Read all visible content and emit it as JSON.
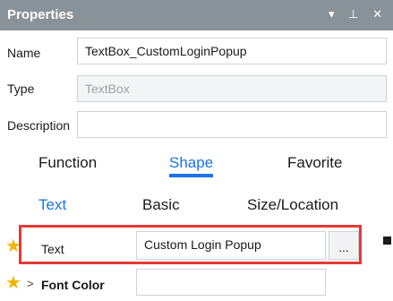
{
  "panel": {
    "title": "Properties",
    "pin_glyph": "▾ ⊥ ✕"
  },
  "fields": {
    "name_label": "Name",
    "name_value": "TextBox_CustomLoginPopup",
    "type_label": "Type",
    "type_value": "TextBox",
    "description_label": "Description",
    "description_value": ""
  },
  "tabs_primary": [
    {
      "label": "Function",
      "active": false
    },
    {
      "label": "Shape",
      "active": true
    },
    {
      "label": "Favorite",
      "active": false
    }
  ],
  "tabs_secondary": [
    {
      "label": "Text",
      "active": true
    },
    {
      "label": "Basic",
      "active": false
    },
    {
      "label": "Size/Location",
      "active": false
    }
  ],
  "properties": {
    "text_label": "Text",
    "text_value": "Custom Login Popup",
    "ellipsis_label": "...",
    "font_color_label": "Font Color",
    "font_color_value": ""
  },
  "colors": {
    "accent": "#1a73e8",
    "highlight": "#e53935",
    "star": "#f2b400",
    "titlebar": "#8a9299"
  }
}
